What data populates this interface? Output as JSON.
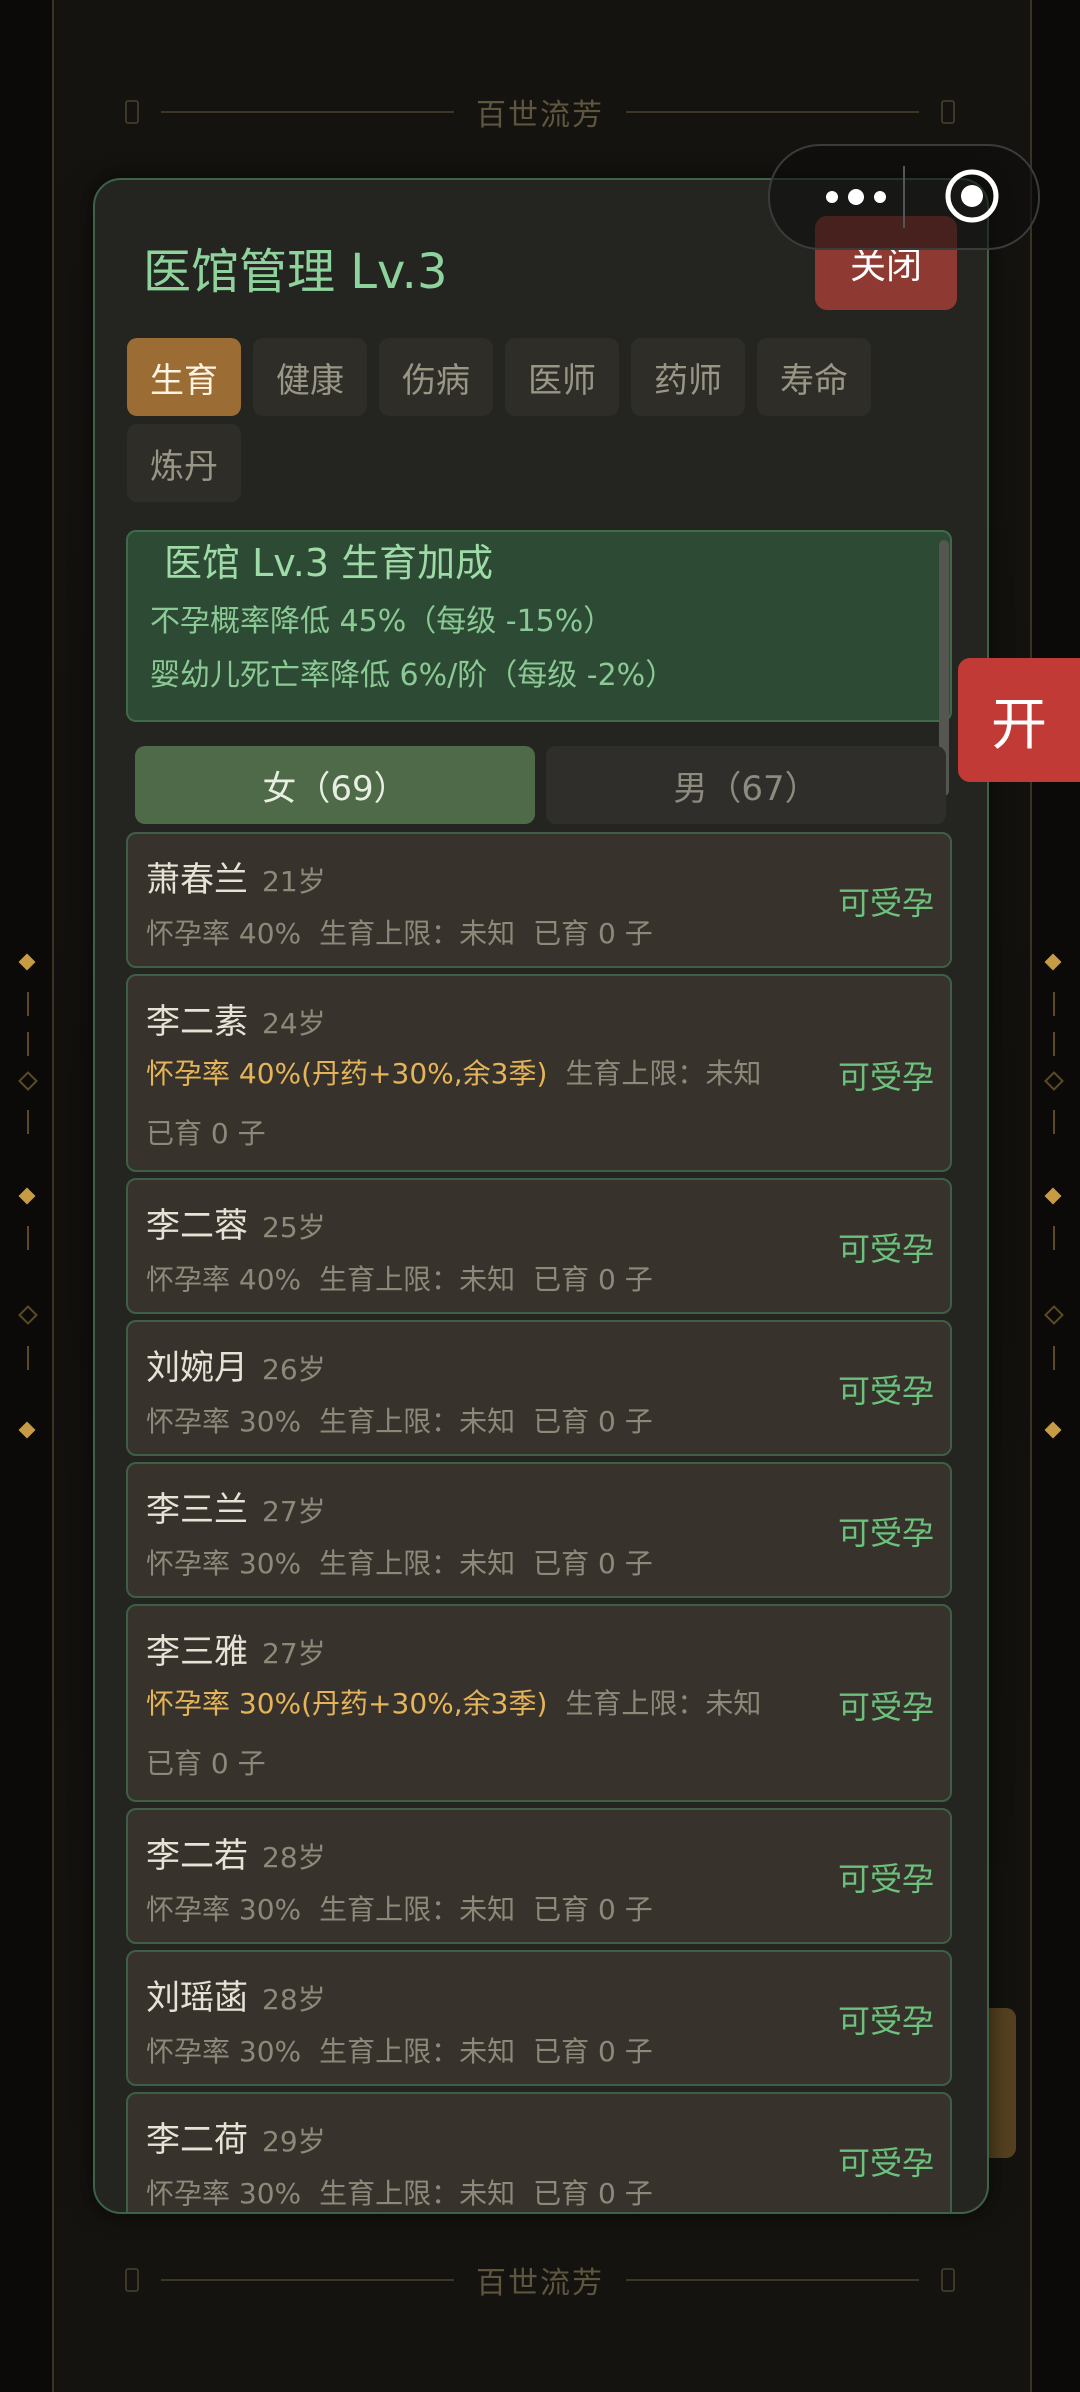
{
  "background": {
    "banner_text": "百世流芳"
  },
  "capsule": {
    "more_icon": "more-dots-icon",
    "close_icon": "target-icon"
  },
  "modal": {
    "title": "医馆管理 Lv.3",
    "close_label": "关闭",
    "tabs": [
      {
        "label": "生育",
        "active": true
      },
      {
        "label": "健康",
        "active": false
      },
      {
        "label": "伤病",
        "active": false
      },
      {
        "label": "医师",
        "active": false
      },
      {
        "label": "药师",
        "active": false
      },
      {
        "label": "寿命",
        "active": false
      },
      {
        "label": "炼丹",
        "active": false
      }
    ],
    "bonus": {
      "title": "医馆 Lv.3 生育加成",
      "lines": [
        "不孕概率降低 45%（每级 -15%）",
        "婴幼儿死亡率降低 6%/阶（每级 -2%）"
      ]
    },
    "gender_tabs": {
      "female": "女（69）",
      "male": "男（67）"
    },
    "people": [
      {
        "name": "萧春兰",
        "age": "21岁",
        "rate": "怀孕率 40%",
        "limit": "生育上限：未知",
        "children": "已育 0 子",
        "status": "可受孕",
        "boosted": false
      },
      {
        "name": "李二素",
        "age": "24岁",
        "rate": "怀孕率 40%(丹药+30%,余3季)",
        "limit": "生育上限：未知",
        "children": "已育 0 子",
        "status": "可受孕",
        "boosted": true
      },
      {
        "name": "李二蓉",
        "age": "25岁",
        "rate": "怀孕率 40%",
        "limit": "生育上限：未知",
        "children": "已育 0 子",
        "status": "可受孕",
        "boosted": false
      },
      {
        "name": "刘婉月",
        "age": "26岁",
        "rate": "怀孕率 30%",
        "limit": "生育上限：未知",
        "children": "已育 0 子",
        "status": "可受孕",
        "boosted": false
      },
      {
        "name": "李三兰",
        "age": "27岁",
        "rate": "怀孕率 30%",
        "limit": "生育上限：未知",
        "children": "已育 0 子",
        "status": "可受孕",
        "boosted": false
      },
      {
        "name": "李三雅",
        "age": "27岁",
        "rate": "怀孕率 30%(丹药+30%,余3季)",
        "limit": "生育上限：未知",
        "children": "已育 0 子",
        "status": "可受孕",
        "boosted": true
      },
      {
        "name": "李二若",
        "age": "28岁",
        "rate": "怀孕率 30%",
        "limit": "生育上限：未知",
        "children": "已育 0 子",
        "status": "可受孕",
        "boosted": false
      },
      {
        "name": "刘瑶菡",
        "age": "28岁",
        "rate": "怀孕率 30%",
        "limit": "生育上限：未知",
        "children": "已育 0 子",
        "status": "可受孕",
        "boosted": false
      },
      {
        "name": "李二荷",
        "age": "29岁",
        "rate": "怀孕率 30%",
        "limit": "生育上限：未知",
        "children": "已育 0 子",
        "status": "可受孕",
        "boosted": false
      }
    ]
  },
  "open_button": "开",
  "colors": {
    "accent_green": "#8fd39c",
    "tab_active": "#9c6c35",
    "close_red": "#8e3a32",
    "status_green": "#6cc27d",
    "boost_gold": "#e6b458"
  }
}
